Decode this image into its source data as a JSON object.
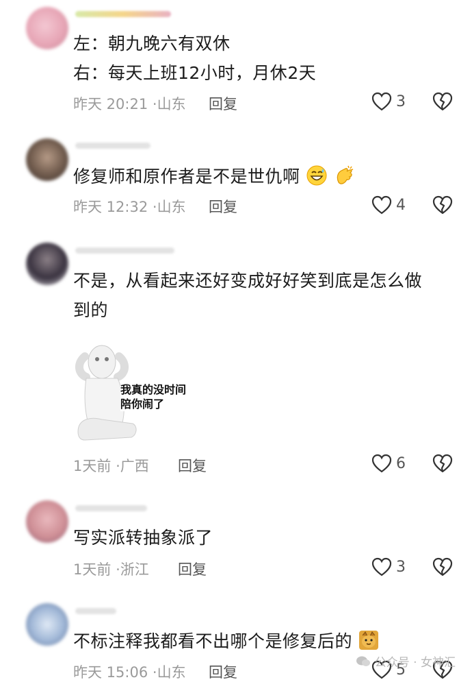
{
  "reply_label": "回复",
  "comments": [
    {
      "lines": [
        "左：朝九晚六有双休",
        "右：每天上班12小时，月休2天"
      ],
      "time": "昨天 20:21",
      "location": "山东",
      "likes": "3",
      "avatar_color": "#e7a6b6"
    },
    {
      "text": "修复师和原作者是不是世仇啊",
      "emojis": [
        "grinning-sweat-emoji",
        "clapping-hands-emoji"
      ],
      "time": "昨天 12:32",
      "location": "山东",
      "likes": "4",
      "avatar_color": "#6f5a4c"
    },
    {
      "text": "不是，从看起来还好变成好好笑到底是怎么做到的",
      "sticker_caption": "我真的没时间\n陪你闹了",
      "time": "1天前",
      "location": "广西",
      "likes": "6",
      "avatar_color": "#3a3340"
    },
    {
      "text": "写实派转抽象派了",
      "time": "1天前",
      "location": "浙江",
      "likes": "3",
      "avatar_color": "#cf8f96"
    },
    {
      "text": "不标注释我都看不出哪个是修复后的",
      "emojis": [
        "cat-emoji"
      ],
      "time": "昨天 15:06",
      "location": "山东",
      "likes": "5",
      "avatar_color": "#9fb6d6"
    }
  ],
  "watermark": "公众号 · 女神汇"
}
